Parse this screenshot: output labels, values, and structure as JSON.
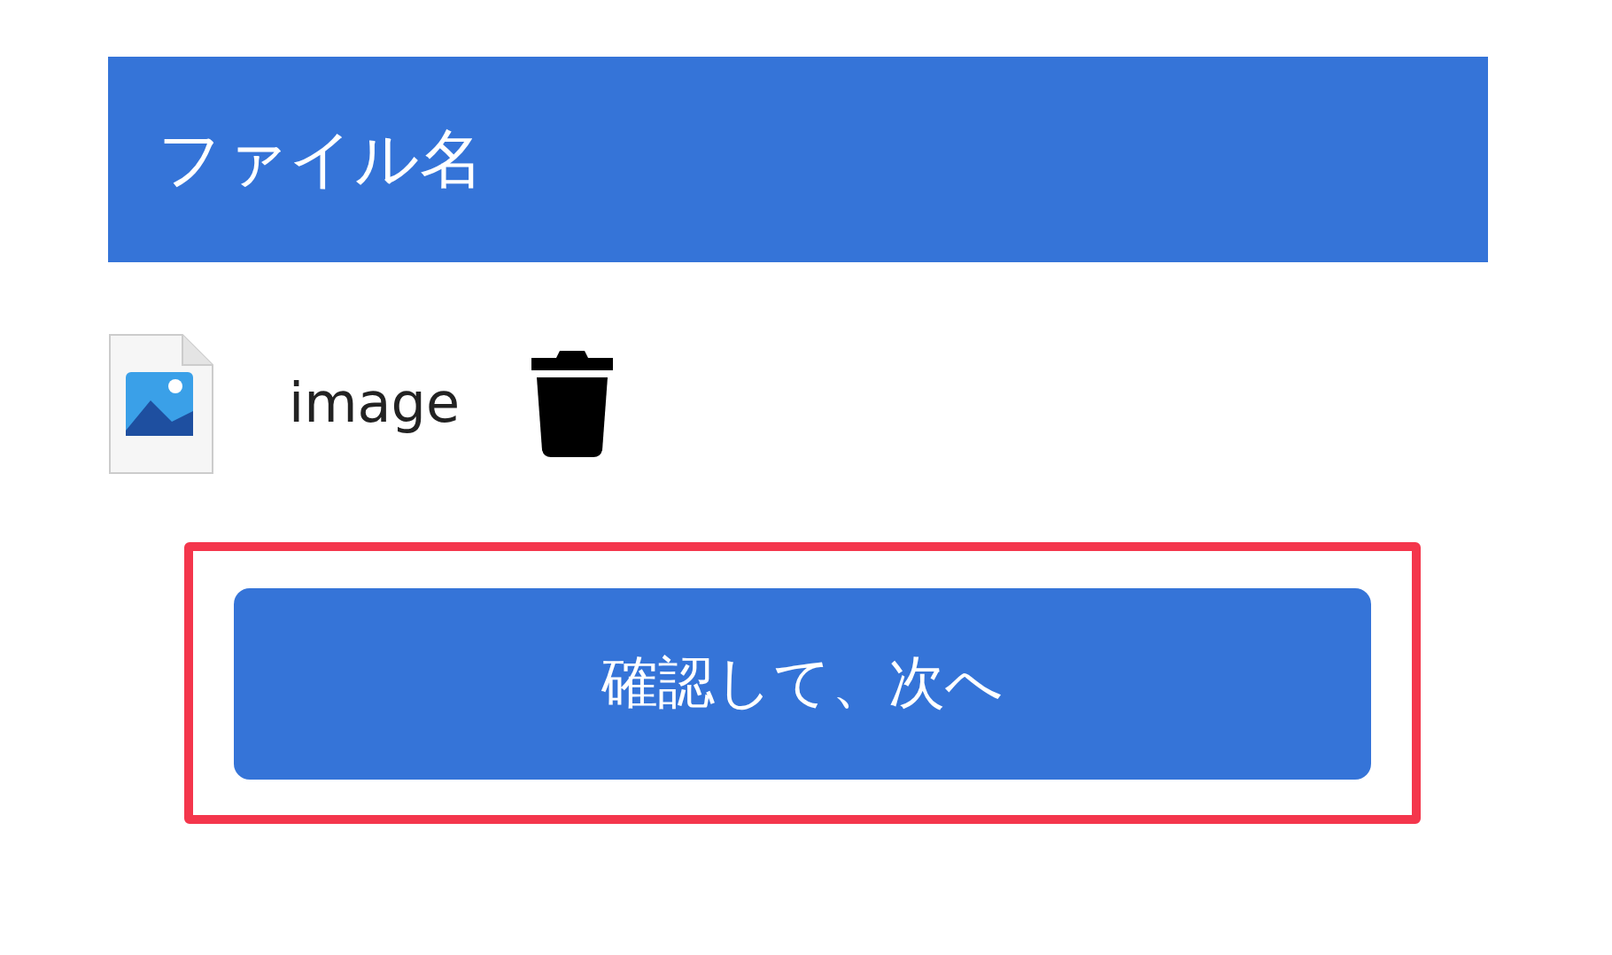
{
  "header": {
    "title": "ファイル名"
  },
  "files": [
    {
      "name": "image"
    }
  ],
  "action": {
    "label": "確認して、次へ",
    "highlighted": true
  }
}
